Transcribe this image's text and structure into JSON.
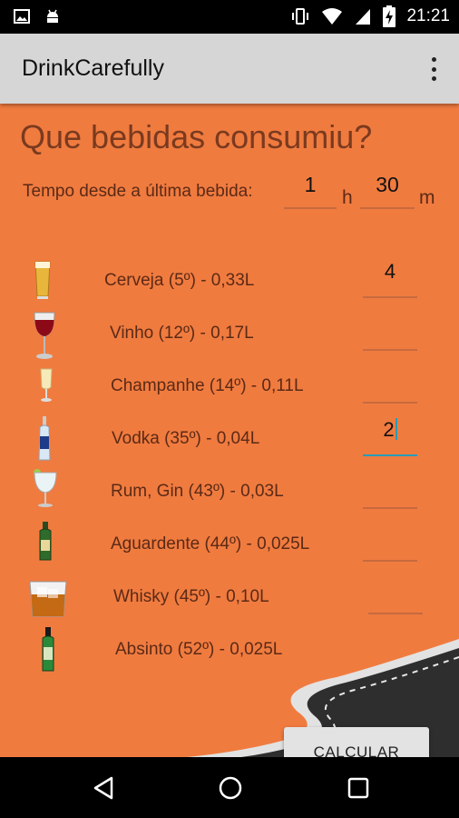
{
  "status_bar": {
    "time": "21:21",
    "icons": [
      "image-icon",
      "android-icon",
      "vibrate-icon",
      "wifi-icon",
      "signal-icon",
      "battery-charging-icon"
    ]
  },
  "app_bar": {
    "title": "DrinkCarefully",
    "menu_icon": "overflow-menu-icon"
  },
  "main": {
    "heading": "Que bebidas consumiu?",
    "time_since": {
      "label": "Tempo desde a última bebida:",
      "hours_value": "1",
      "hours_unit": "h",
      "minutes_value": "30",
      "minutes_unit": "m"
    },
    "drinks": [
      {
        "icon": "beer-glass-icon",
        "label": "Cerveja (5º) - 0,33L",
        "quantity": "4"
      },
      {
        "icon": "wine-glass-icon",
        "label": "Vinho (12º) - 0,17L",
        "quantity": ""
      },
      {
        "icon": "champagne-glass-icon",
        "label": "Champanhe (14º) - 0,11L",
        "quantity": ""
      },
      {
        "icon": "vodka-bottle-icon",
        "label": "Vodka (35º) - 0,04L",
        "quantity": "2"
      },
      {
        "icon": "gin-glass-icon",
        "label": "Rum, Gin (43º) - 0,03L",
        "quantity": ""
      },
      {
        "icon": "aguardente-bottle-icon",
        "label": "Aguardente (44º) - 0,025L",
        "quantity": ""
      },
      {
        "icon": "whisky-glass-icon",
        "label": "Whisky (45º) - 0,10L",
        "quantity": ""
      },
      {
        "icon": "absinto-bottle-icon",
        "label": "Absinto (52º) - 0,025L",
        "quantity": ""
      }
    ],
    "calculate_label": "CALCULAR"
  },
  "nav_bar": {
    "icons": [
      "back-icon",
      "home-icon",
      "recents-icon"
    ]
  },
  "colors": {
    "background": "#f07b3f",
    "app_bar": "#d6d6d6",
    "accent": "#2a9bb5"
  }
}
